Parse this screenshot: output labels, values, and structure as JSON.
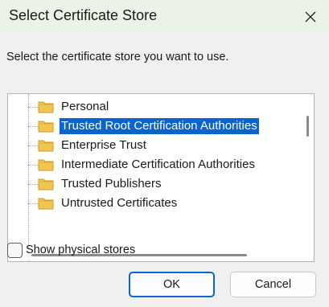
{
  "window": {
    "title": "Select Certificate Store",
    "close_icon": "close-icon"
  },
  "prompt": "Select the certificate store you want to use.",
  "tree": {
    "items": [
      {
        "label": "Personal",
        "icon": "folder-icon",
        "selected": false
      },
      {
        "label": "Trusted Root Certification Authorities",
        "icon": "folder-icon",
        "selected": true
      },
      {
        "label": "Enterprise Trust",
        "icon": "folder-icon",
        "selected": false
      },
      {
        "label": "Intermediate Certification Authorities",
        "icon": "folder-icon",
        "selected": false
      },
      {
        "label": "Trusted Publishers",
        "icon": "folder-icon",
        "selected": false
      },
      {
        "label": "Untrusted Certificates",
        "icon": "folder-icon",
        "selected": false
      }
    ]
  },
  "show_physical": {
    "label": "Show physical stores",
    "checked": false
  },
  "buttons": {
    "ok": "OK",
    "cancel": "Cancel"
  },
  "colors": {
    "selection": "#0a64d0",
    "folder": "#f2c64f"
  }
}
